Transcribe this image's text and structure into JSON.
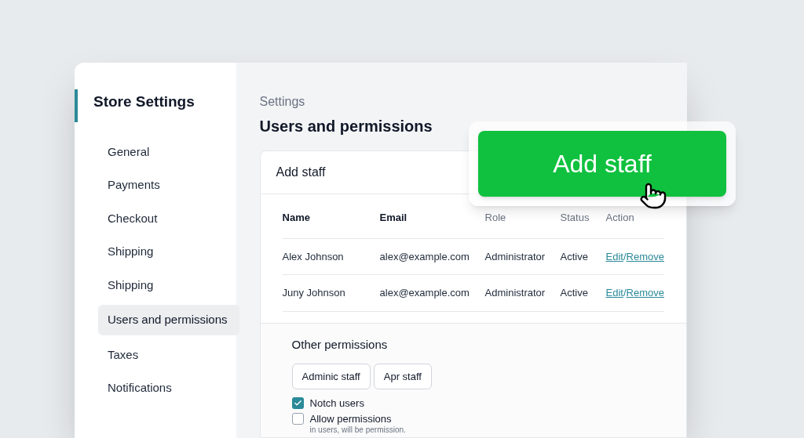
{
  "sidebar": {
    "title": "Store Settings",
    "items": [
      {
        "label": "General",
        "selected": false
      },
      {
        "label": "Payments",
        "selected": false
      },
      {
        "label": "Checkout",
        "selected": false
      },
      {
        "label": "Shipping",
        "selected": false
      },
      {
        "label": "Shipping",
        "selected": false
      },
      {
        "label": "Users and permissions",
        "selected": true
      },
      {
        "label": "Taxes",
        "selected": false
      },
      {
        "label": "Notifications",
        "selected": false
      }
    ]
  },
  "breadcrumb": "Settings",
  "page_title": "Users and permissions",
  "card": {
    "title": "Add staff",
    "columns": [
      "Name",
      "Email",
      "Role",
      "Status",
      "Action"
    ],
    "rows": [
      {
        "name": "Alex Johnson",
        "email": "alex@example.com",
        "role": "Administrator",
        "status": "Active",
        "edit": "Edit",
        "separator": "/",
        "remove": "Remove"
      },
      {
        "name": "Juny Johnson",
        "email": "alex@example.com",
        "role": "Administrator",
        "status": "Active",
        "edit": "Edit",
        "separator": "/",
        "remove": "Remove"
      }
    ]
  },
  "other_permissions": {
    "title": "Other permissions",
    "buttons": [
      "Adminic staff",
      "Apr staff"
    ],
    "options": [
      {
        "label": "Notch users",
        "checked": true
      },
      {
        "label": "Allow permissions",
        "checked": false,
        "hint": "in users, will be permission."
      }
    ]
  },
  "add_staff_button": "Add staff"
}
